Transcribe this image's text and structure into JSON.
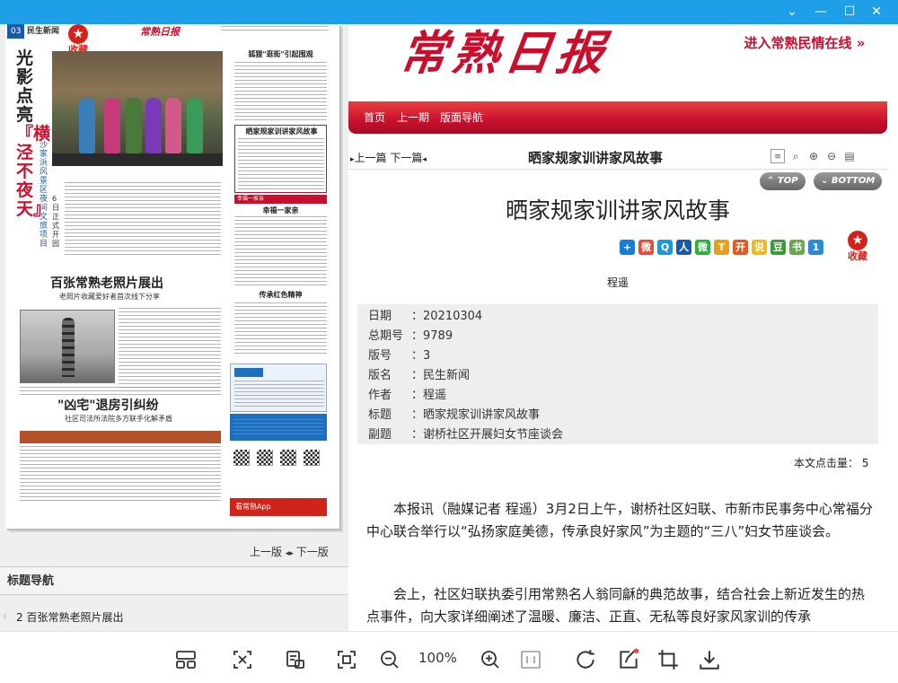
{
  "window": {
    "minimize": "⌄",
    "restore": "—",
    "maximize": "☐",
    "close": "✕"
  },
  "paper": {
    "page_tag": "03",
    "section": "民生新闻",
    "masthead": "常熟日报",
    "collect_label": "收藏",
    "headline_black": "光影点亮",
    "headline_red": "『横泾不夜天』",
    "photo_caption": "沙家浜风景区夜间文旅项目",
    "headline_2_sub": "6日正式开园",
    "col_title_1": "狐狸\"逛街\"引起围观",
    "boxed_title": "晒家规家训讲家风故事",
    "red_head": "幸福一家亲",
    "col_title_2": "幸福一家亲",
    "col_title_3": "传承红色精神",
    "title_photos": "百张常熟老照片展出",
    "title_photos_sub": "老照片收藏爱好者首次线下分享",
    "title_house": "\"凶宅\"退房引纠纷",
    "title_house_sub": "社区司法所法院多方联手化解矛盾",
    "app_label": "看常熟App"
  },
  "pager": {
    "prev": "上一版",
    "next": "下一版"
  },
  "nav": {
    "header": "标题导航",
    "items": [
      "2 百张常熟老照片展出"
    ]
  },
  "site": {
    "masthead": "常熟日报",
    "minqing_link": "进入常熟民情在线 »",
    "nav": [
      "首页",
      "上一期",
      "版面导航"
    ],
    "prev_article": "上一篇",
    "next_article": "下一篇",
    "bar_title": "晒家规家训讲家风故事",
    "top_button": "TOP",
    "bottom_button": "BOTTOM",
    "collect_label": "收藏"
  },
  "article": {
    "title": "晒家规家训讲家风故事",
    "author": "程遥",
    "meta": [
      {
        "key": "日期",
        "value": "20210304"
      },
      {
        "key": "总期号",
        "value": "9789"
      },
      {
        "key": "版号",
        "value": "3"
      },
      {
        "key": "版名",
        "value": "民生新闻"
      },
      {
        "key": "作者",
        "value": "程遥"
      },
      {
        "key": "标题",
        "value": "晒家规家训讲家风故事"
      },
      {
        "key": "副题",
        "value": "谢桥社区开展妇女节座谈会"
      }
    ],
    "hits_label": "本文点击量：",
    "hits": "5",
    "paragraphs": [
      "本报讯（融媒记者 程遥）3月2日上午，谢桥社区妇联、市新市民事务中心常福分中心联合举行以“弘扬家庭美德，传承良好家风”为主题的“三八”妇女节座谈会。",
      "会上，社区妇联执委引用常熟名人翁同龢的典范故事，结合社会上新近发生的热点事件，向大家详细阐述了温暖、廉洁、正直、无私等良好家风家训的传承"
    ]
  },
  "viewer": {
    "zoom": "100%"
  },
  "colors": {
    "accent": "#1e9fe8",
    "brand_red": "#c8102e"
  }
}
